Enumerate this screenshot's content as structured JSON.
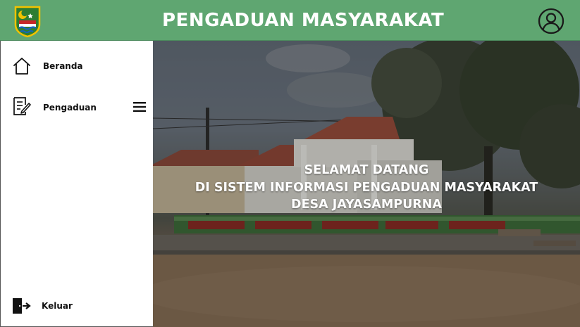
{
  "header": {
    "title": "PENGADUAN MASYARAKAT",
    "logo_icon": "regency-emblem-icon",
    "account_icon": "user-circle-icon",
    "background_color": "#5fa671"
  },
  "sidebar": {
    "items": [
      {
        "label": "Beranda",
        "icon": "home-icon"
      },
      {
        "label": "Pengaduan",
        "icon": "complaint-document-icon",
        "menu_icon": "hamburger-menu-icon"
      }
    ],
    "logout": {
      "label": "Keluar",
      "icon": "logout-door-icon"
    }
  },
  "hero": {
    "lines": [
      "SELAMAT DATANG",
      "DI SISTEM INFORMASI PENGADUAN MASYARAKAT",
      "DESA JAYASAMPURNA"
    ],
    "text_color": "#ffffff"
  }
}
